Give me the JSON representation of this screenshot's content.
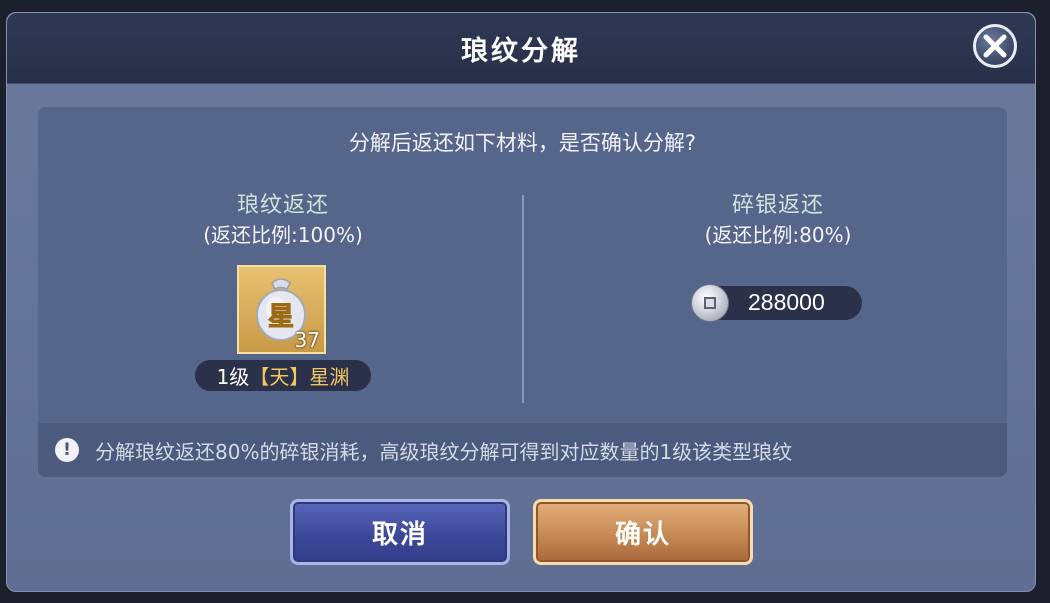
{
  "dialog": {
    "title": "琅纹分解",
    "close_icon": "close-icon"
  },
  "panel": {
    "question": "分解后返还如下材料，是否确认分解?",
    "left": {
      "title": "琅纹返还",
      "subtitle": "(返还比例:100%)",
      "item": {
        "icon": "star-bag-icon",
        "glyph": "星",
        "count": "37",
        "name_level": "1级",
        "name_quality": "【天】",
        "name_text": "星渊"
      }
    },
    "right": {
      "title": "碎银返还",
      "subtitle": "(返还比例:80%)",
      "currency_icon": "silver-coin-icon",
      "amount": "288000"
    },
    "tip": {
      "icon": "info-icon",
      "icon_glyph": "!",
      "text": "分解琅纹返还80%的碎银消耗，高级琅纹分解可得到对应数量的1级该类型琅纹"
    }
  },
  "buttons": {
    "cancel": "取消",
    "confirm": "确认"
  },
  "colors": {
    "header_bg": "#2f3853",
    "panel_bg": "#56658a",
    "cancel_blue": "#3b4697",
    "confirm_gold": "#c38552",
    "quality_gold": "#f2c661"
  }
}
